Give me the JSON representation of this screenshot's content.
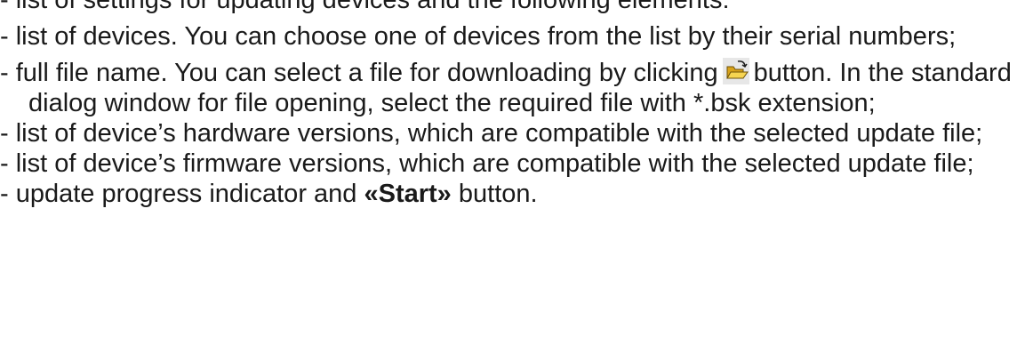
{
  "items": [
    {
      "text": "- list of settings for updating devices and the following elements:"
    },
    {
      "text": "- list of devices. You can choose one of devices from the list by their serial numbers;"
    },
    {
      "before_icon": "- full file name. You can select a file for downloading by clicking",
      "icon": "open-folder-icon",
      "after_icon": "button. In the standard dialog window for file opening, select the required file with *.bsk extension;"
    },
    {
      "text": "- list of device’s hardware versions, which are compatible with the selected update file;"
    },
    {
      "text": "- list of device’s firmware versions, which are compatible with the selected update file;"
    },
    {
      "before_bold": "- update progress indicator and",
      "bold": "«Start»",
      "after_bold": "button."
    }
  ]
}
